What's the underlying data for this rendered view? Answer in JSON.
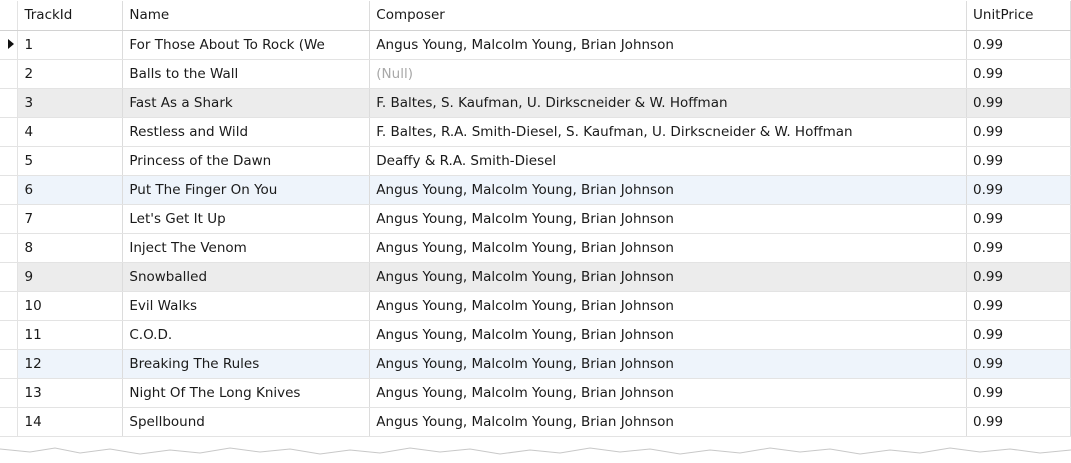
{
  "columns": [
    "TrackId",
    "Name",
    "Composer",
    "UnitPrice"
  ],
  "rows": [
    {
      "id": "1",
      "name": "For Those About To Rock (We",
      "composer": "Angus Young, Malcolm Young, Brian Johnson",
      "price": "0.99",
      "current": true,
      "tint": ""
    },
    {
      "id": "2",
      "name": "Balls to the Wall",
      "composer": "(Null)",
      "price": "0.99",
      "current": false,
      "tint": "",
      "null_composer": true
    },
    {
      "id": "3",
      "name": "Fast As a Shark",
      "composer": "F. Baltes, S. Kaufman, U. Dirkscneider & W. Hoffman",
      "price": "0.99",
      "current": false,
      "tint": "gray"
    },
    {
      "id": "4",
      "name": "Restless and Wild",
      "composer": "F. Baltes, R.A. Smith-Diesel, S. Kaufman, U. Dirkscneider & W. Hoffman",
      "price": "0.99",
      "current": false,
      "tint": ""
    },
    {
      "id": "5",
      "name": "Princess of the Dawn",
      "composer": "Deaffy & R.A. Smith-Diesel",
      "price": "0.99",
      "current": false,
      "tint": ""
    },
    {
      "id": "6",
      "name": "Put The Finger On You",
      "composer": "Angus Young, Malcolm Young, Brian Johnson",
      "price": "0.99",
      "current": false,
      "tint": "blue"
    },
    {
      "id": "7",
      "name": "Let's Get It Up",
      "composer": "Angus Young, Malcolm Young, Brian Johnson",
      "price": "0.99",
      "current": false,
      "tint": ""
    },
    {
      "id": "8",
      "name": "Inject The Venom",
      "composer": "Angus Young, Malcolm Young, Brian Johnson",
      "price": "0.99",
      "current": false,
      "tint": ""
    },
    {
      "id": "9",
      "name": "Snowballed",
      "composer": "Angus Young, Malcolm Young, Brian Johnson",
      "price": "0.99",
      "current": false,
      "tint": "gray"
    },
    {
      "id": "10",
      "name": "Evil Walks",
      "composer": "Angus Young, Malcolm Young, Brian Johnson",
      "price": "0.99",
      "current": false,
      "tint": ""
    },
    {
      "id": "11",
      "name": "C.O.D.",
      "composer": "Angus Young, Malcolm Young, Brian Johnson",
      "price": "0.99",
      "current": false,
      "tint": ""
    },
    {
      "id": "12",
      "name": "Breaking The Rules",
      "composer": "Angus Young, Malcolm Young, Brian Johnson",
      "price": "0.99",
      "current": false,
      "tint": "blue"
    },
    {
      "id": "13",
      "name": "Night Of The Long Knives",
      "composer": "Angus Young, Malcolm Young, Brian Johnson",
      "price": "0.99",
      "current": false,
      "tint": ""
    },
    {
      "id": "14",
      "name": "Spellbound",
      "composer": "Angus Young, Malcolm Young, Brian Johnson",
      "price": "0.99",
      "current": false,
      "tint": ""
    }
  ],
  "icons": {
    "current_row": "row-pointer-arrow-icon"
  },
  "colors": {
    "null_text": "#a8a8a8",
    "blue_row": "#eef4fb",
    "gray_row": "#ececec"
  }
}
